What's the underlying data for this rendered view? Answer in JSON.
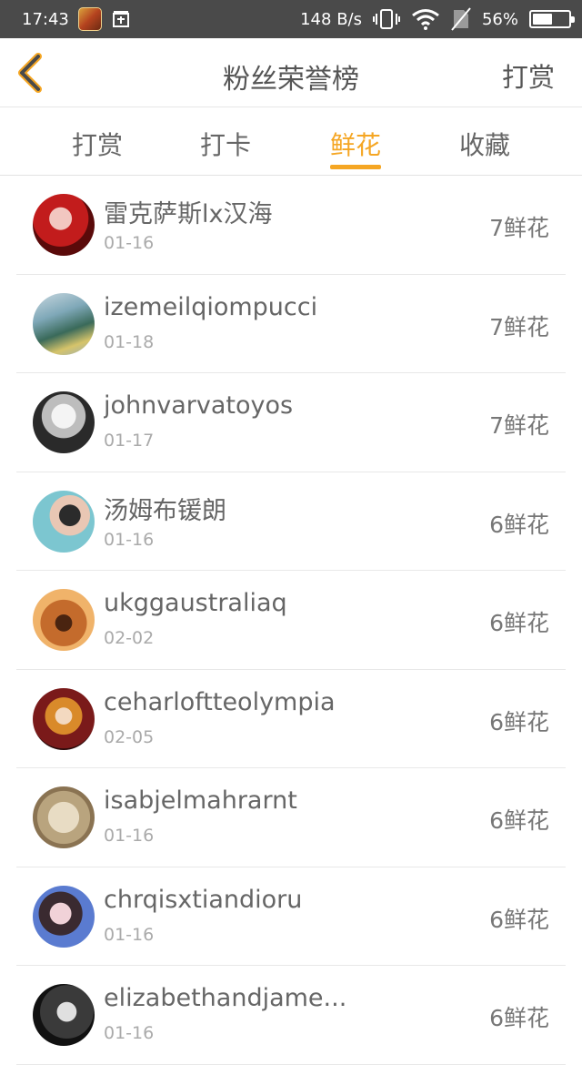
{
  "status_bar": {
    "time": "17:43",
    "network_speed": "148 B/s",
    "battery_percent": "56%",
    "battery_level": 0.56,
    "icons": [
      "game-app-icon",
      "notification-icon",
      "vibrate-icon",
      "wifi-icon",
      "no-sim-icon",
      "battery-icon"
    ]
  },
  "nav": {
    "back_icon": "chevron-left-icon",
    "title": "粉丝荣誉榜",
    "action_label": "打赏"
  },
  "tabs": [
    {
      "label": "打赏",
      "active": false
    },
    {
      "label": "打卡",
      "active": false
    },
    {
      "label": "鲜花",
      "active": true
    },
    {
      "label": "收藏",
      "active": false
    }
  ],
  "accent_color": "#f5a623",
  "list": [
    {
      "name": "雷克萨斯lx汉海",
      "date": "01-16",
      "value": "7鲜花"
    },
    {
      "name": "izemeilqiompucci",
      "date": "01-18",
      "value": "7鲜花"
    },
    {
      "name": "johnvarvatoyos",
      "date": "01-17",
      "value": "7鲜花"
    },
    {
      "name": "汤姆布锾朗",
      "date": "01-16",
      "value": "6鲜花"
    },
    {
      "name": "ukggaustraliaq",
      "date": "02-02",
      "value": "6鲜花"
    },
    {
      "name": "ceharloftteolympia",
      "date": "02-05",
      "value": "6鲜花"
    },
    {
      "name": "isabjelmahrarnt",
      "date": "01-16",
      "value": "6鲜花"
    },
    {
      "name": "chrqisxtiandioru",
      "date": "01-16",
      "value": "6鲜花"
    },
    {
      "name": "elizabethandjame...",
      "date": "01-16",
      "value": "6鲜花"
    }
  ]
}
